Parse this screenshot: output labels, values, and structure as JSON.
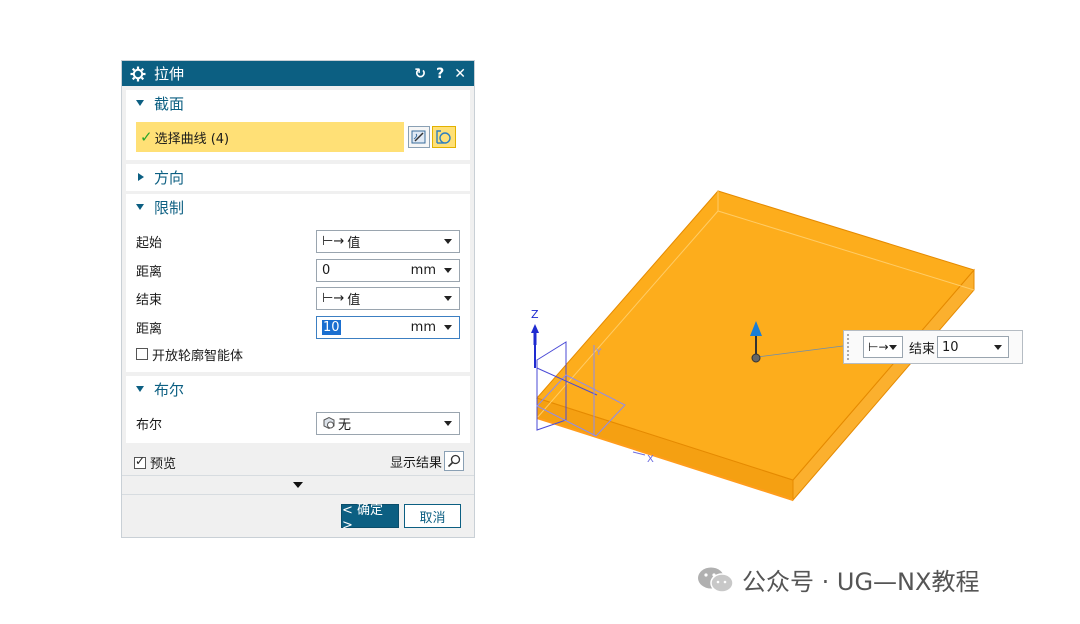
{
  "dialog": {
    "title": "拉伸",
    "title_buttons": {
      "reset": "↻",
      "help": "?",
      "close": "✕"
    },
    "sections": {
      "section": {
        "label": "截面",
        "select_curve": "选择曲线 (4)"
      },
      "direction": {
        "label": "方向"
      },
      "limits": {
        "label": "限制",
        "start_label": "起始",
        "start_value": "值",
        "start_distance_label": "距离",
        "start_distance": "0",
        "start_unit": "mm",
        "end_label": "结束",
        "end_value": "值",
        "end_distance_label": "距离",
        "end_distance": "10",
        "end_unit": "mm",
        "open_profile_label": "开放轮廓智能体"
      },
      "boolean": {
        "label": "布尔",
        "field_label": "布尔",
        "value": "无"
      }
    },
    "preview_label": "预览",
    "show_result_label": "显示结果",
    "ok_label": "< 确定 >",
    "cancel_label": "取消"
  },
  "viewport": {
    "axis_z": "Z",
    "axis_x": "X",
    "axis_y": "Y",
    "handle_popup": {
      "end_label": "结束",
      "value": "10"
    },
    "body_color": "#fdad1c",
    "edge_color": "#e58a00"
  },
  "watermark": "公众号 · UG—NX教程",
  "colors": {
    "accent": "#0c5f82",
    "selection": "#ffe076"
  }
}
